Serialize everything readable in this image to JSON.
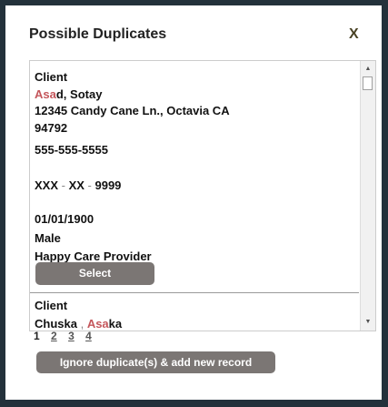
{
  "dialog": {
    "title": "Possible Duplicates",
    "close_label": "X"
  },
  "records": [
    {
      "heading": "Client",
      "name_highlight": "Asa",
      "name_rest": "d, Sotay",
      "address_line1": "12345 Candy Cane Ln., Octavia CA",
      "address_line2": "94792",
      "phone": "555-555-5555",
      "ssn_a": "XXX",
      "ssn_sep1": " - ",
      "ssn_b": "XX",
      "ssn_sep2": " - ",
      "ssn_c": "9999",
      "dob": "01/01/1900",
      "gender": "Male",
      "provider": "Happy Care Provider",
      "select_label": "Select"
    },
    {
      "heading": "Client",
      "name_part1": "Chuska",
      "name_sep": " , ",
      "name_highlight": "Asa",
      "name_rest": "ka"
    }
  ],
  "pagination": {
    "current": "1",
    "pages": [
      "2",
      "3",
      "4"
    ]
  },
  "ignore_button_label": "Ignore duplicate(s) & add new record",
  "icons": {
    "scroll_up": "▲",
    "scroll_down": "▼"
  },
  "colors": {
    "backdrop": "#23313b",
    "button": "#7b7674",
    "highlight": "#c4565b"
  }
}
